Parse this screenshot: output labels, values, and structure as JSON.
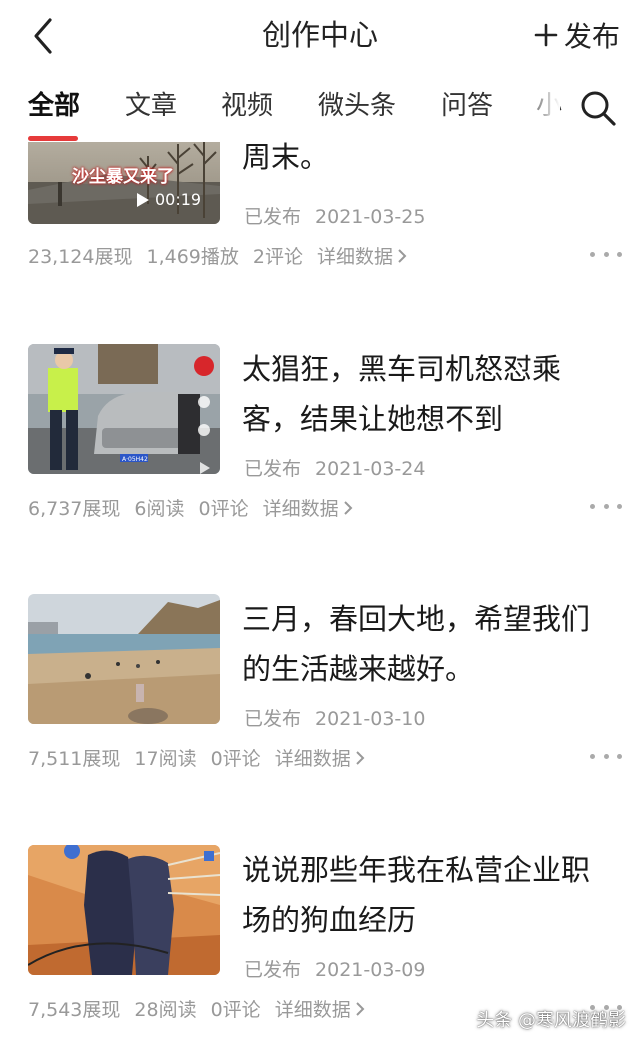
{
  "header": {
    "title": "创作中心",
    "publish_label": "发布",
    "back_icon": "back-chevron-icon",
    "publish_icon": "plus-icon"
  },
  "tabs": [
    {
      "label": "全部",
      "active": true
    },
    {
      "label": "文章"
    },
    {
      "label": "视频"
    },
    {
      "label": "微头条"
    },
    {
      "label": "问答"
    },
    {
      "label": "小"
    }
  ],
  "accent_color": "#e63a3a",
  "items": [
    {
      "title": "周末。",
      "status": "已发布",
      "date": "2021-03-25",
      "stats": [
        "23,124展现",
        "1,469播放",
        "2评论"
      ],
      "detail_label": "详细数据",
      "thumb_caption": "沙尘暴又来了",
      "video_duration": "00:19"
    },
    {
      "title": "太猖狂，黑车司机怒怼乘客，结果让她想不到",
      "status": "已发布",
      "date": "2021-03-24",
      "stats": [
        "6,737展现",
        "6阅读",
        "0评论"
      ],
      "detail_label": "详细数据",
      "plate_text": "A·05H42"
    },
    {
      "title": "三月，春回大地，希望我们的生活越来越好。",
      "status": "已发布",
      "date": "2021-03-10",
      "stats": [
        "7,511展现",
        "17阅读",
        "0评论"
      ],
      "detail_label": "详细数据"
    },
    {
      "title": "说说那些年我在私营企业职场的狗血经历",
      "status": "已发布",
      "date": "2021-03-09",
      "stats": [
        "7,543展现",
        "28阅读",
        "0评论"
      ],
      "detail_label": "详细数据"
    }
  ],
  "watermark": "头条 @寒风渡鹤影"
}
